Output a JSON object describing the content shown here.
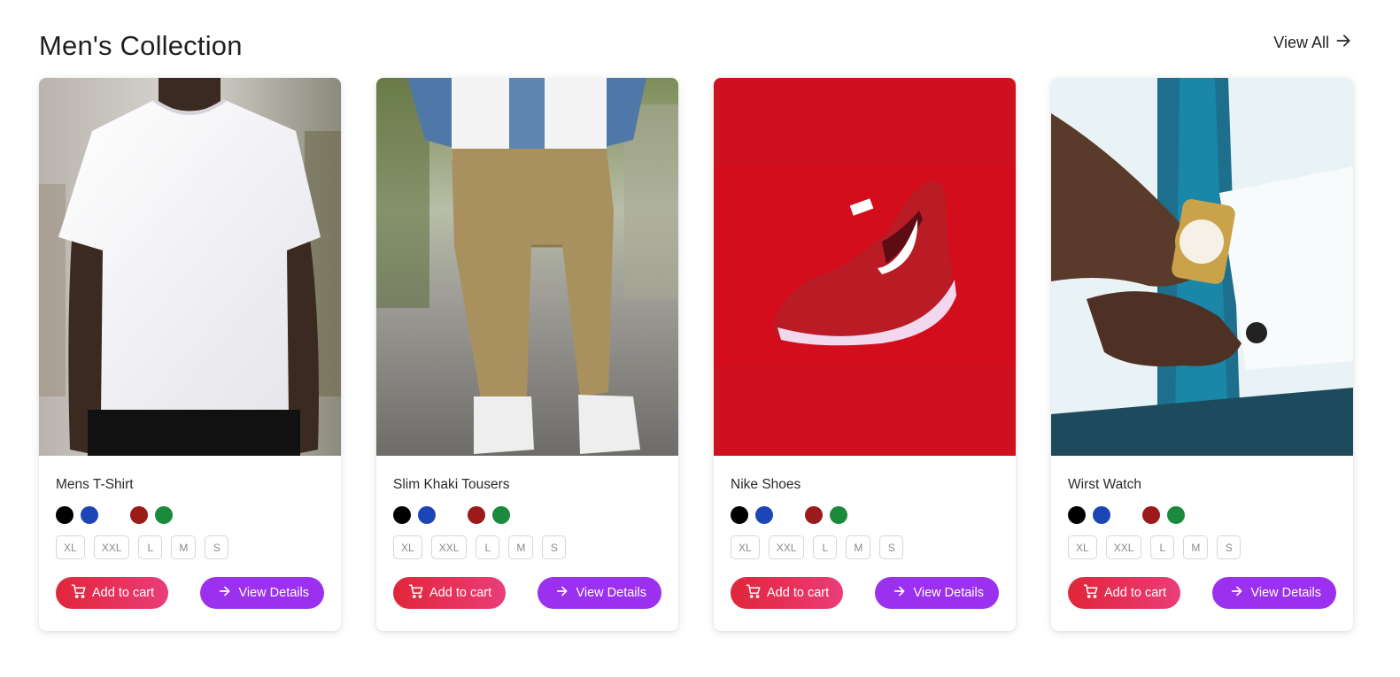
{
  "header": {
    "title": "Men's Collection",
    "view_all": "View All"
  },
  "icons": {
    "view_all": "arrow-right-icon",
    "cart": "cart-icon",
    "details": "arrow-right-icon"
  },
  "colors": {
    "cart_gradient": [
      "#e0263a",
      "#ea3d78"
    ],
    "view_button": "#9b30ef"
  },
  "swatch_colors": [
    "#000000",
    "#1c45b5",
    "#ffffff",
    "#9b1b1b",
    "#1b8a3c"
  ],
  "products": [
    {
      "name": "Mens T-Shirt",
      "image": "white-tshirt",
      "sizes": [
        "XL",
        "XXL",
        "L",
        "M",
        "S"
      ],
      "add_label": "Add to cart",
      "view_label": "View Details"
    },
    {
      "name": "Slim Khaki Tousers",
      "image": "khaki-trousers",
      "sizes": [
        "XL",
        "XXL",
        "L",
        "M",
        "S"
      ],
      "add_label": "Add to cart",
      "view_label": "View Details"
    },
    {
      "name": "Nike Shoes",
      "image": "red-nike-shoe",
      "sizes": [
        "XL",
        "XXL",
        "L",
        "M",
        "S"
      ],
      "add_label": "Add to cart",
      "view_label": "View Details"
    },
    {
      "name": "Wirst Watch",
      "image": "gold-wrist-watch",
      "sizes": [
        "XL",
        "XXL",
        "L",
        "M",
        "S"
      ],
      "add_label": "Add to cart",
      "view_label": "View Details"
    }
  ]
}
